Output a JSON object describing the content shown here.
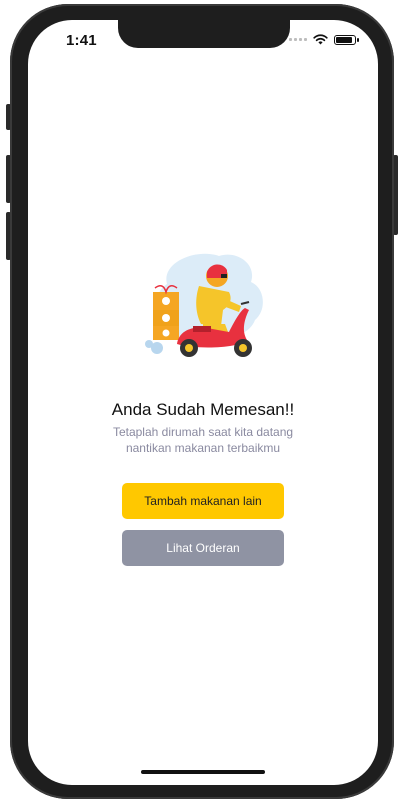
{
  "status_bar": {
    "time": "1:41",
    "battery_level": 0.9
  },
  "confirmation": {
    "title": "Anda Sudah Memesan!!",
    "subtitle_line1": "Tetaplah dirumah saat kita datang",
    "subtitle_line2": "nantikan makanan terbaikmu"
  },
  "actions": {
    "add_food_label": "Tambah makanan lain",
    "view_order_label": "Lihat Orderan"
  },
  "colors": {
    "primary": "#ffc800",
    "secondary": "#8f93a3",
    "text_muted": "#8a8aa0",
    "scooter": "#e8313f"
  },
  "icons": [
    "wifi-icon",
    "battery-icon",
    "delivery-scooter-illustration"
  ]
}
